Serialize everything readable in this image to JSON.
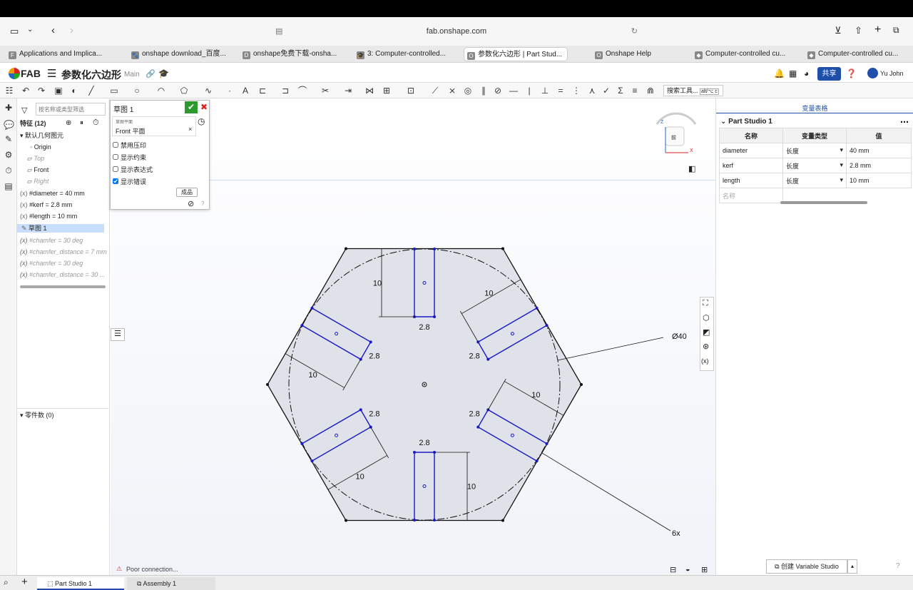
{
  "browser": {
    "url": "fab.onshape.com",
    "tabs": [
      {
        "label": "Applications and Implica...",
        "icon": "F"
      },
      {
        "label": "onshape download_百度...",
        "icon": "🐾"
      },
      {
        "label": "onshape免费下载-onsha...",
        "icon": "D"
      },
      {
        "label": "3: Computer-controlled...",
        "icon": "🎓"
      },
      {
        "label": "参数化六边形 | Part Stud...",
        "icon": "O",
        "active": true
      },
      {
        "label": "Onshape Help",
        "icon": "O"
      },
      {
        "label": "Computer-controlled cu...",
        "icon": "◆"
      },
      {
        "label": "Computer-controlled cu...",
        "icon": "◆"
      }
    ]
  },
  "app": {
    "logo": "FAB",
    "doc_title": "参数化六边形",
    "branch": "Main",
    "share": "共享",
    "user": "Yu John"
  },
  "toolbar": {
    "search": "搜索工具...",
    "shortcut": "alt/⌥ c"
  },
  "features": {
    "filter_placeholder": "按名称或类型筛选",
    "header": "特征 (12)",
    "default_geo": "默认几何图元",
    "items": [
      {
        "label": "Origin",
        "dim": false
      },
      {
        "label": "Top",
        "dim": true
      },
      {
        "label": "Front",
        "dim": false
      },
      {
        "label": "Right",
        "dim": true
      },
      {
        "label": "#diameter = 40 mm",
        "dim": false
      },
      {
        "label": "#kerf = 2.8 mm",
        "dim": false
      },
      {
        "label": "#length = 10 mm",
        "dim": false
      },
      {
        "label": "草图 1",
        "dim": false,
        "selected": true
      },
      {
        "label": "#chamfer = 30 deg",
        "dim": true
      },
      {
        "label": "#chamfer_distance = 7 mm",
        "dim": true
      },
      {
        "label": "#chamfer = 30 deg",
        "dim": true
      },
      {
        "label": "#chamfer_distance = 30 ...",
        "dim": true
      }
    ],
    "parts": "零件数 (0)"
  },
  "sketch_panel": {
    "title": "草图 1",
    "plane_label": "草图平面",
    "plane_value": "Front 平面",
    "options": [
      {
        "label": "禁用压印",
        "checked": false
      },
      {
        "label": "显示约束",
        "checked": false
      },
      {
        "label": "显示表达式",
        "checked": false
      },
      {
        "label": "显示错误",
        "checked": true
      }
    ],
    "finish": "成品"
  },
  "viewcube": {
    "face": "前",
    "z": "Z",
    "x": "X"
  },
  "dims": {
    "d10": "10",
    "d28": "2.8",
    "d40": "Ø40",
    "count": "6x",
    "fx": "fx"
  },
  "status": {
    "conn": "Poor connection..."
  },
  "right": {
    "header": "变量表格",
    "studio": "Part Studio 1",
    "columns": [
      "名称",
      "变量类型",
      "值"
    ],
    "rows": [
      {
        "name": "diameter",
        "type": "长度",
        "value": "40 mm"
      },
      {
        "name": "kerf",
        "type": "长度",
        "value": "2.8 mm"
      },
      {
        "name": "length",
        "type": "长度",
        "value": "10 mm"
      }
    ],
    "new_placeholder": "名称",
    "create_btn": "创建 Variable Studio"
  },
  "bottom": {
    "tabs": [
      "Part Studio 1",
      "Assembly 1"
    ]
  },
  "colors": {
    "accent": "#1f4fa8",
    "slot": "#1a1ac4",
    "sketch": "#111111",
    "fill": "#dfe2e8"
  }
}
